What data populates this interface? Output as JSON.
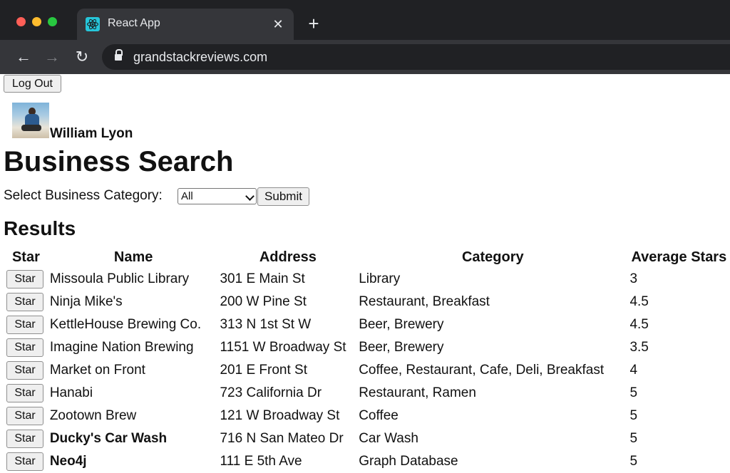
{
  "browser": {
    "tab_title": "React App",
    "tab_close": "✕",
    "new_tab": "+",
    "url": "grandstackreviews.com",
    "back": "←",
    "forward": "→",
    "reload": "↻"
  },
  "header": {
    "logout_label": "Log Out",
    "username": "William Lyon"
  },
  "search": {
    "title": "Business Search",
    "category_label": "Select Business Category:",
    "selected_category": "All",
    "submit_label": "Submit"
  },
  "results": {
    "title": "Results",
    "columns": {
      "star": "Star",
      "name": "Name",
      "address": "Address",
      "category": "Category",
      "average_stars": "Average Stars"
    },
    "star_button_label": "Star",
    "rows": [
      {
        "name": "Missoula Public Library",
        "address": "301 E Main St",
        "category": "Library",
        "average_stars": "3",
        "bold": false
      },
      {
        "name": "Ninja Mike's",
        "address": "200 W Pine St",
        "category": "Restaurant, Breakfast",
        "average_stars": "4.5",
        "bold": false
      },
      {
        "name": "KettleHouse Brewing Co.",
        "address": "313 N 1st St W",
        "category": "Beer, Brewery",
        "average_stars": "4.5",
        "bold": false
      },
      {
        "name": "Imagine Nation Brewing",
        "address": "1151 W Broadway St",
        "category": "Beer, Brewery",
        "average_stars": "3.5",
        "bold": false
      },
      {
        "name": "Market on Front",
        "address": "201 E Front St",
        "category": "Coffee, Restaurant, Cafe, Deli, Breakfast",
        "average_stars": "4",
        "bold": false
      },
      {
        "name": "Hanabi",
        "address": "723 California Dr",
        "category": "Restaurant, Ramen",
        "average_stars": "5",
        "bold": false
      },
      {
        "name": "Zootown Brew",
        "address": "121 W Broadway St",
        "category": "Coffee",
        "average_stars": "5",
        "bold": false
      },
      {
        "name": "Ducky's Car Wash",
        "address": "716 N San Mateo Dr",
        "category": "Car Wash",
        "average_stars": "5",
        "bold": true
      },
      {
        "name": "Neo4j",
        "address": "111 E 5th Ave",
        "category": "Graph Database",
        "average_stars": "5",
        "bold": true
      }
    ]
  }
}
